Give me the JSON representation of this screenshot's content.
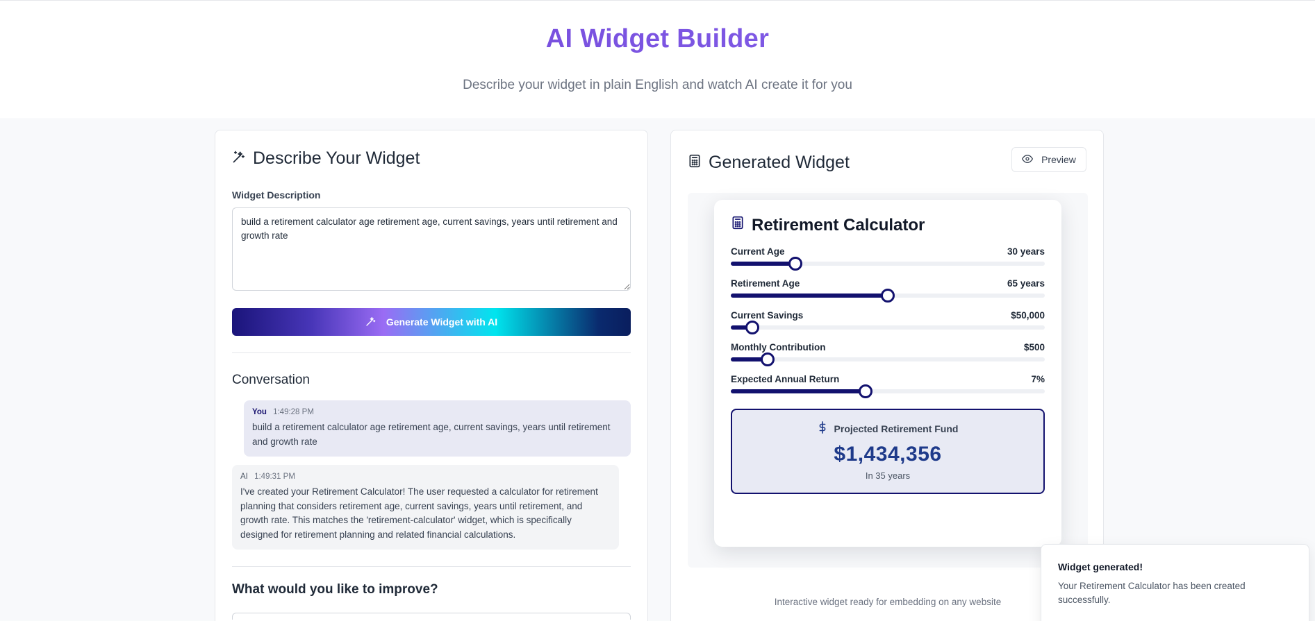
{
  "header": {
    "title": "AI Widget Builder",
    "subtitle": "Describe your widget in plain English and watch AI create it for you"
  },
  "left_panel": {
    "heading": "Describe Your Widget",
    "heading_icon": "magic-wand-icon",
    "description_label": "Widget Description",
    "description_value": "build a retirement calculator age retirement age, current savings, years until retirement and growth rate",
    "generate_button_label": "Generate Widget with AI",
    "conversation_title": "Conversation",
    "messages": [
      {
        "author": "You",
        "time": "1:49:28 PM",
        "text": "build a retirement calculator age retirement age, current savings, years until retirement and growth rate"
      },
      {
        "author": "AI",
        "time": "1:49:31 PM",
        "text": "I've created your Retirement Calculator! The user requested a calculator for retirement planning that considers retirement age, current savings, years until retirement, and growth rate. This matches the 'retirement-calculator' widget, which is specifically designed for retirement planning and related financial calculations."
      }
    ],
    "improve_title": "What would you like to improve?"
  },
  "right_panel": {
    "heading": "Generated Widget",
    "heading_icon": "calculator-icon",
    "preview_button_label": "Preview",
    "preview_icon": "eye-icon",
    "widget": {
      "title": "Retirement Calculator",
      "title_icon": "calculator-icon",
      "sliders": [
        {
          "label": "Current Age",
          "value": "30 years",
          "fraction": 0.205
        },
        {
          "label": "Retirement Age",
          "value": "65 years",
          "fraction": 0.5
        },
        {
          "label": "Current Savings",
          "value": "$50,000",
          "fraction": 0.068
        },
        {
          "label": "Monthly Contribution",
          "value": "$500",
          "fraction": 0.117
        },
        {
          "label": "Expected Annual Return",
          "value": "7%",
          "fraction": 0.43
        }
      ],
      "result_label": "Projected Retirement Fund",
      "result_icon": "dollar-icon",
      "result_value": "$1,434,356",
      "result_sub": "In 35 years",
      "accent_color": "#12116e"
    },
    "embed_note": "Interactive widget ready for embedding on any website"
  },
  "toast": {
    "title": "Widget generated!",
    "body": "Your Retirement Calculator has been created successfully."
  }
}
